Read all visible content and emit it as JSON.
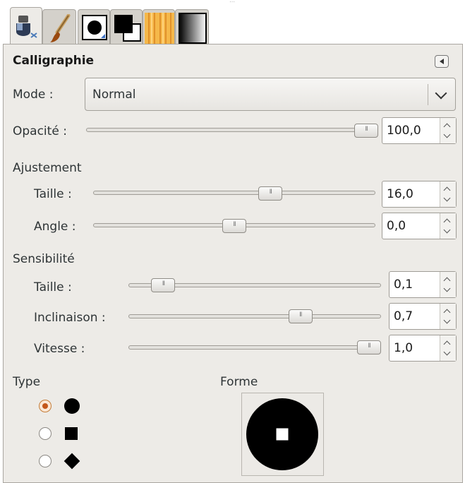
{
  "tabs": [
    {
      "name": "tool-options",
      "icon": "tool-options-icon"
    },
    {
      "name": "brushes",
      "icon": "paintbrush-icon"
    },
    {
      "name": "brush-shape",
      "icon": "brush-circle-icon"
    },
    {
      "name": "colors",
      "icon": "fg-bg-colors-icon"
    },
    {
      "name": "patterns",
      "icon": "wood-pattern-icon"
    },
    {
      "name": "gradients",
      "icon": "gradient-icon"
    }
  ],
  "panel": {
    "title": "Calligraphie"
  },
  "mode": {
    "label": "Mode :",
    "value": "Normal"
  },
  "opacity": {
    "label": "Opacité :",
    "value": "100,0",
    "fraction": 1.0
  },
  "adjustment": {
    "heading": "Ajustement",
    "size": {
      "label": "Taille :",
      "value": "16,0",
      "fraction": 0.64
    },
    "angle": {
      "label": "Angle :",
      "value": "0,0",
      "fraction": 0.5
    }
  },
  "sensitivity": {
    "heading": "Sensibilité",
    "size": {
      "label": "Taille :",
      "value": "0,1",
      "fraction": 0.1
    },
    "tilt": {
      "label": "Inclinaison :",
      "value": "0,7",
      "fraction": 0.7
    },
    "speed": {
      "label": "Vitesse :",
      "value": "1,0",
      "fraction": 1.0
    }
  },
  "type": {
    "heading": "Type",
    "options": [
      "circle",
      "square",
      "diamond"
    ],
    "selected": 0
  },
  "shape": {
    "heading": "Forme"
  }
}
